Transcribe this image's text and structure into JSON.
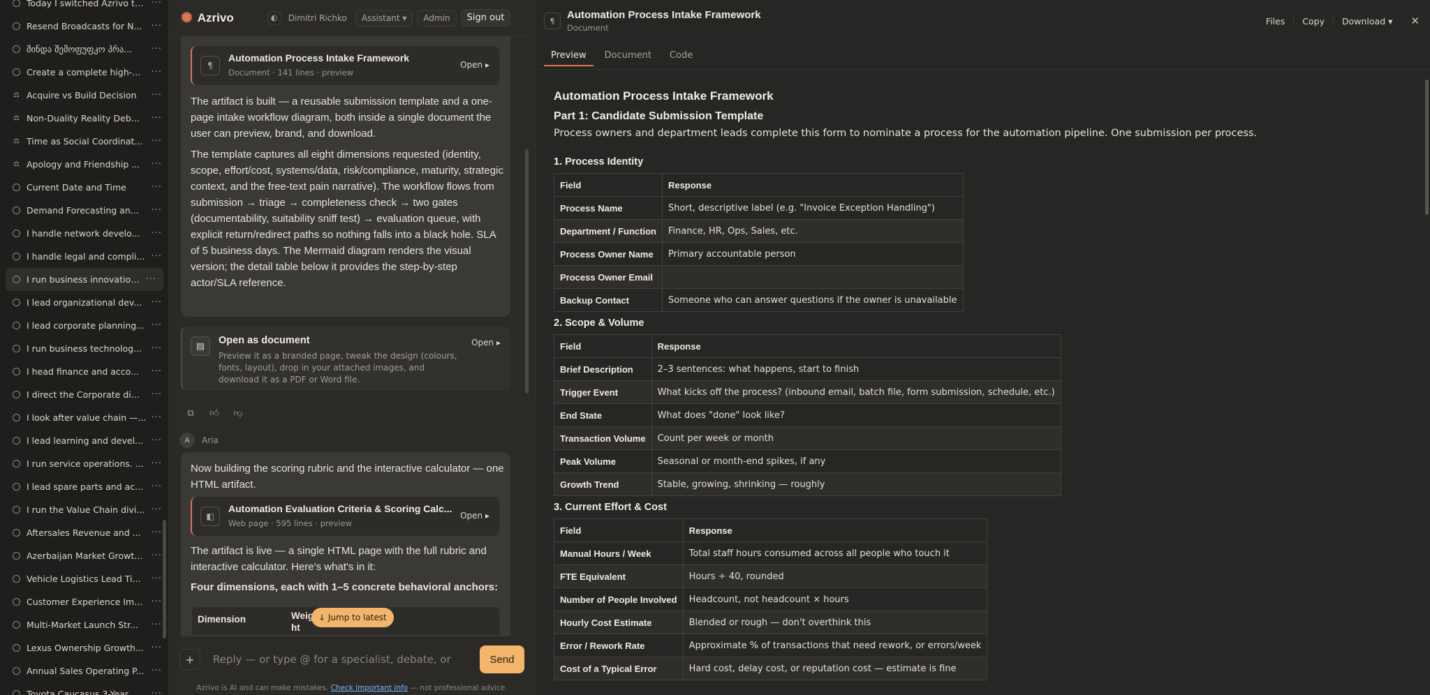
{
  "sidebar": {
    "items": [
      {
        "label": "Today I switched Azrivo to...",
        "icon": "circle"
      },
      {
        "label": "Resend Broadcasts for N...",
        "icon": "circle"
      },
      {
        "label": "მინდა შემოფუფკო პრა...",
        "icon": "circle"
      },
      {
        "label": "Create a complete high-...",
        "icon": "circle"
      },
      {
        "label": "Acquire vs Build Decision",
        "icon": "debate"
      },
      {
        "label": "Non-Duality Reality Deb...",
        "icon": "debate"
      },
      {
        "label": "Time as Social Coordinat...",
        "icon": "debate"
      },
      {
        "label": "Apology and Friendship ...",
        "icon": "debate"
      },
      {
        "label": "Current Date and Time",
        "icon": "circle"
      },
      {
        "label": "Demand Forecasting an...",
        "icon": "circle"
      },
      {
        "label": "I handle network develo...",
        "icon": "circle"
      },
      {
        "label": "I handle legal and compli...",
        "icon": "circle"
      },
      {
        "label": "I run business innovation...",
        "icon": "circle",
        "active": true
      },
      {
        "label": "I lead organizational dev...",
        "icon": "circle"
      },
      {
        "label": "I lead corporate planning...",
        "icon": "circle"
      },
      {
        "label": "I run business technolog...",
        "icon": "circle"
      },
      {
        "label": "I head finance and acco...",
        "icon": "circle"
      },
      {
        "label": "I direct the Corporate di...",
        "icon": "circle"
      },
      {
        "label": "I look after value chain —...",
        "icon": "circle"
      },
      {
        "label": "I lead learning and devel...",
        "icon": "circle"
      },
      {
        "label": "I run service operations. ...",
        "icon": "circle"
      },
      {
        "label": "I lead spare parts and ac...",
        "icon": "circle"
      },
      {
        "label": "I run the Value Chain divi...",
        "icon": "circle"
      },
      {
        "label": "Aftersales Revenue and ...",
        "icon": "circle"
      },
      {
        "label": "Azerbaijan Market Growt...",
        "icon": "circle"
      },
      {
        "label": "Vehicle Logistics Lead Ti...",
        "icon": "circle"
      },
      {
        "label": "Customer Experience Im...",
        "icon": "circle"
      },
      {
        "label": "Multi-Market Launch Str...",
        "icon": "circle"
      },
      {
        "label": "Lexus Ownership Growth...",
        "icon": "circle"
      },
      {
        "label": "Annual Sales Operating P...",
        "icon": "circle"
      },
      {
        "label": "Toyota Caucasus 3-Year ...",
        "icon": "circle"
      }
    ],
    "more_label": "···"
  },
  "topbar": {
    "brand": "Azrivo",
    "user": "Dimitri Richko",
    "mode": "Assistant",
    "admin": "Admin",
    "sign_out": "Sign out"
  },
  "chat": {
    "artifact1": {
      "title": "Automation Process Intake Framework",
      "sub": "Document · 141 lines · preview",
      "open": "Open"
    },
    "msg1_p1": "The artifact is built — a reusable submission template and a one-page intake workflow diagram, both inside a single document the user can preview, brand, and download.",
    "msg1_p2": "The template captures all eight dimensions requested (identity, scope, effort/cost, systems/data, risk/compliance, maturity, strategic context, and the free-text pain narrative). The workflow flows from submission → triage → completeness check → two gates (documentability, suitability sniff test) → evaluation queue, with explicit return/redirect paths so nothing falls into a black hole. SLA of 5 business days. The Mermaid diagram renders the visual version; the detail table below it provides the step-by-step actor/SLA reference.",
    "open_doc": {
      "title": "Open as document",
      "desc": "Preview it as a branded page, tweak the design (colours, fonts, layout), drop in your attached images, and download it as a PDF or Word file.",
      "open": "Open"
    },
    "speaker": {
      "initial": "A",
      "name": "Aria"
    },
    "msg2_p1": "Now building the scoring rubric and the interactive calculator — one HTML artifact.",
    "artifact2": {
      "title": "Automation Evaluation Criteria & Scoring Calc...",
      "sub": "Web page · 595 lines · preview",
      "open": "Open"
    },
    "msg2_p2": "The artifact is live — a single HTML page with the full rubric and interactive calculator. Here's what's in it:",
    "msg2_h": "Four dimensions, each with 1–5 concrete behavioral anchors:",
    "mini_table": {
      "col1": "Dimension",
      "col2": "Weig ht"
    },
    "jump": "↓ Jump to latest",
    "composer_placeholder": "Reply — or type @ for a specialist, debate, or",
    "send": "Send",
    "disclaimer_pre": "Azrivo is AI and can make mistakes.",
    "disclaimer_link": "Check important info",
    "disclaimer_post": "— not professional advice."
  },
  "doc": {
    "title": "Automation Process Intake Framework",
    "subtitle": "Document",
    "actions": [
      "Files",
      "Copy",
      "Download"
    ],
    "tabs": [
      "Preview",
      "Document",
      "Code"
    ],
    "h1": "Automation Process Intake Framework",
    "h2": "Part 1: Candidate Submission Template",
    "lead": "Process owners and department leads complete this form to nominate a process for the automation pipeline. One submission per process.",
    "sections": [
      {
        "title": "1. Process Identity",
        "head": [
          "Field",
          "Response"
        ],
        "rows": [
          [
            "Process Name",
            "Short, descriptive label (e.g. \"Invoice Exception Handling\")"
          ],
          [
            "Department / Function",
            "Finance, HR, Ops, Sales, etc."
          ],
          [
            "Process Owner Name",
            "Primary accountable person"
          ],
          [
            "Process Owner Email",
            ""
          ],
          [
            "Backup Contact",
            "Someone who can answer questions if the owner is unavailable"
          ]
        ]
      },
      {
        "title": "2. Scope & Volume",
        "head": [
          "Field",
          "Response"
        ],
        "rows": [
          [
            "Brief Description",
            "2–3 sentences: what happens, start to finish"
          ],
          [
            "Trigger Event",
            "What kicks off the process? (inbound email, batch file, form submission, schedule, etc.)"
          ],
          [
            "End State",
            "What does \"done\" look like?"
          ],
          [
            "Transaction Volume",
            "Count per week or month"
          ],
          [
            "Peak Volume",
            "Seasonal or month-end spikes, if any"
          ],
          [
            "Growth Trend",
            "Stable, growing, shrinking — roughly"
          ]
        ]
      },
      {
        "title": "3. Current Effort & Cost",
        "head": [
          "Field",
          "Response"
        ],
        "rows": [
          [
            "Manual Hours / Week",
            "Total staff hours consumed across all people who touch it"
          ],
          [
            "FTE Equivalent",
            "Hours ÷ 40, rounded"
          ],
          [
            "Number of People Involved",
            "Headcount, not headcount × hours"
          ],
          [
            "Hourly Cost Estimate",
            "Blended or rough — don't overthink this"
          ],
          [
            "Error / Rework Rate",
            "Approximate % of transactions that need rework, or errors/week"
          ],
          [
            "Cost of a Typical Error",
            "Hard cost, delay cost, or reputation cost — estimate is fine"
          ]
        ]
      }
    ]
  }
}
